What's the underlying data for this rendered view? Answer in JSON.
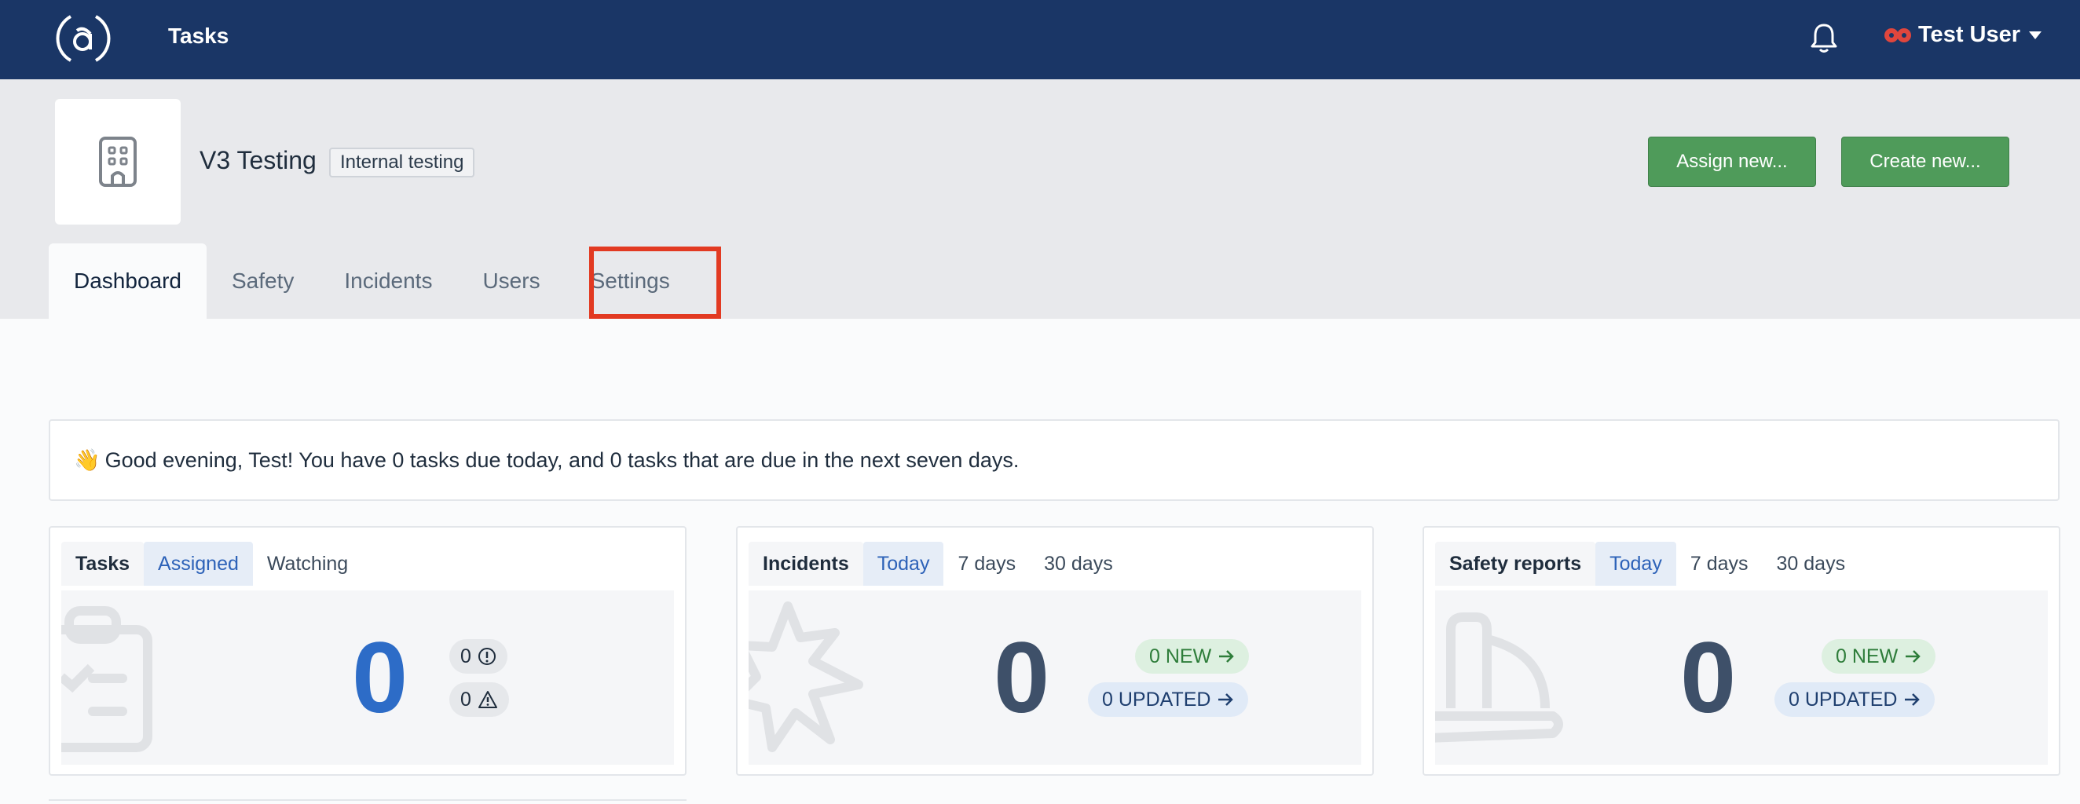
{
  "topbar": {
    "app_title": "Tasks",
    "user_name": "Test User"
  },
  "org": {
    "name": "V3 Testing",
    "tag": "Internal testing"
  },
  "actions": {
    "assign": "Assign new...",
    "create": "Create new..."
  },
  "tabs": [
    {
      "label": "Dashboard"
    },
    {
      "label": "Safety"
    },
    {
      "label": "Incidents"
    },
    {
      "label": "Users"
    },
    {
      "label": "Settings"
    }
  ],
  "greeting": {
    "emoji": "👋",
    "text": "Good evening, Test! You have 0 tasks due today, and 0 tasks that are due in the next seven days."
  },
  "cards": {
    "tasks": {
      "title": "Tasks",
      "tabs": [
        "Assigned",
        "Watching"
      ],
      "count": "0",
      "overdue": "0",
      "warning": "0"
    },
    "incidents": {
      "title": "Incidents",
      "tabs": [
        "Today",
        "7 days",
        "30 days"
      ],
      "count": "0",
      "new": "0 NEW",
      "updated": "0 UPDATED"
    },
    "safety": {
      "title": "Safety reports",
      "tabs": [
        "Today",
        "7 days",
        "30 days"
      ],
      "count": "0",
      "new": "0 NEW",
      "updated": "0 UPDATED"
    }
  },
  "colors": {
    "topbar": "#1a3666",
    "accent_blue": "#2d6cc7",
    "green_button": "#4f9b5a",
    "highlight": "#e23a22"
  }
}
